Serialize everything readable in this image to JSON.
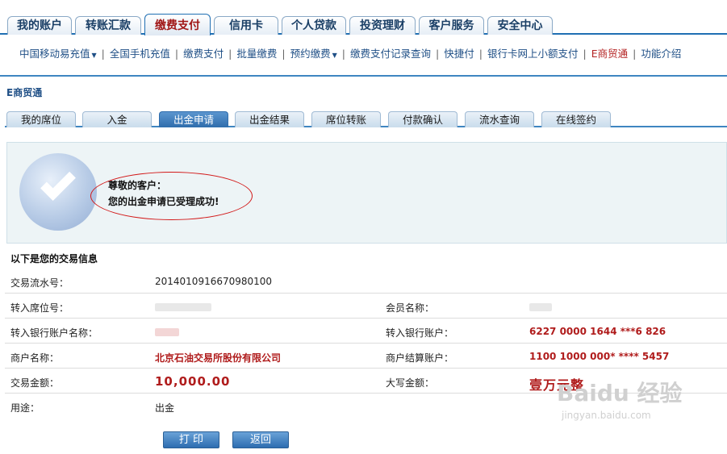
{
  "top_tabs": [
    {
      "label": "我的账户"
    },
    {
      "label": "转账汇款"
    },
    {
      "label": "缴费支付",
      "active": true
    },
    {
      "label": "信用卡"
    },
    {
      "label": "个人贷款"
    },
    {
      "label": "投资理财"
    },
    {
      "label": "客户服务"
    },
    {
      "label": "安全中心"
    }
  ],
  "subnav": [
    {
      "label": "中国移动易充值",
      "dropdown": true
    },
    {
      "label": "全国手机充值"
    },
    {
      "label": "缴费支付"
    },
    {
      "label": "批量缴费"
    },
    {
      "label": "预约缴费",
      "dropdown": true
    },
    {
      "label": "缴费支付记录查询"
    },
    {
      "label": "快捷付"
    },
    {
      "label": "银行卡网上小额支付"
    },
    {
      "label": "E商贸通",
      "highlight": true
    },
    {
      "label": "功能介绍"
    }
  ],
  "section_title": "E商贸通",
  "inner_tabs": [
    {
      "label": "我的席位"
    },
    {
      "label": "入金"
    },
    {
      "label": "出金申请",
      "active": true
    },
    {
      "label": "出金结果"
    },
    {
      "label": "席位转账"
    },
    {
      "label": "付款确认"
    },
    {
      "label": "流水查询"
    },
    {
      "label": "在线签约"
    }
  ],
  "success": {
    "title": "尊敬的客户：",
    "message": "您的出金申请已受理成功!"
  },
  "info_heading": "以下是您的交易信息",
  "fields": {
    "serial_label": "交易流水号：",
    "serial_value": "2014010916670980100",
    "seat_label": "转入席位号：",
    "seat_value": "",
    "member_label": "会员名称：",
    "member_value": "",
    "account_name_label": "转入银行账户名称：",
    "account_name_value": "",
    "bank_account_label": "转入银行账户：",
    "bank_account_value": "6227 0000 1644 ***6 826",
    "merchant_label": "商户名称：",
    "merchant_value": "北京石油交易所股份有限公司",
    "settle_account_label": "商户结算账户：",
    "settle_account_value": "1100 1000 000* **** 5457",
    "amount_label": "交易金额：",
    "amount_value": "10,000.00",
    "amount_words_label": "大写金额：",
    "amount_words_value": "壹万元整",
    "purpose_label": "用途：",
    "purpose_value": "出金"
  },
  "buttons": {
    "print": "打 印",
    "back": "返回"
  },
  "watermark": {
    "main": "Baidu 经验",
    "sub": "jingyan.baidu.com"
  }
}
